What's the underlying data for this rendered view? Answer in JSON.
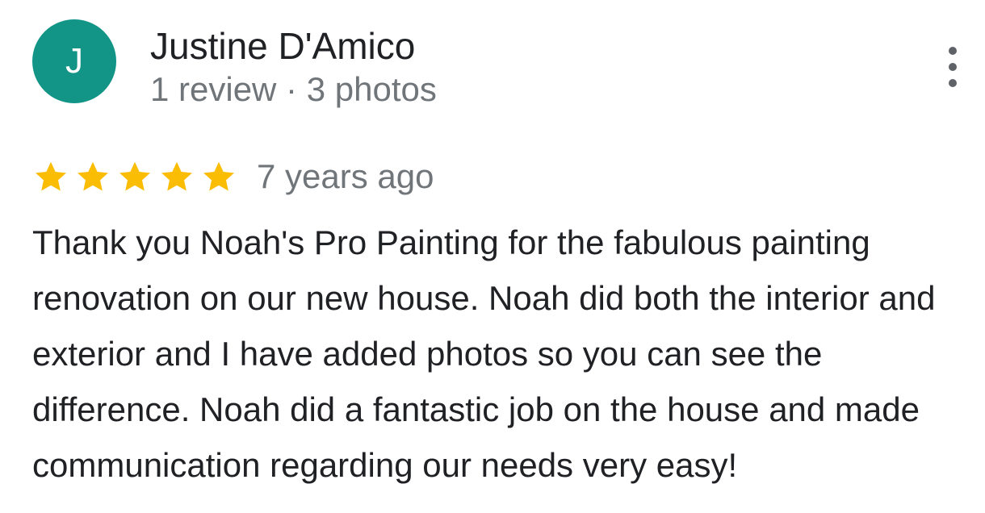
{
  "reviewer": {
    "initial": "J",
    "name": "Justine D'Amico",
    "meta": "1 review · 3 photos",
    "avatar_color": "#129487"
  },
  "rating": {
    "stars": 5,
    "max_stars": 5,
    "star_color": "#FBBC04",
    "time_ago": "7 years ago"
  },
  "review": {
    "text": "Thank you Noah's Pro Painting for the fabulous painting renovation on our new house. Noah did both the interior and exterior and I have added photos so you can see the difference. Noah did a fantastic job on the house and made communication regarding our needs very easy!"
  },
  "icons": {
    "more": "more-vert-icon",
    "star": "star-icon"
  }
}
